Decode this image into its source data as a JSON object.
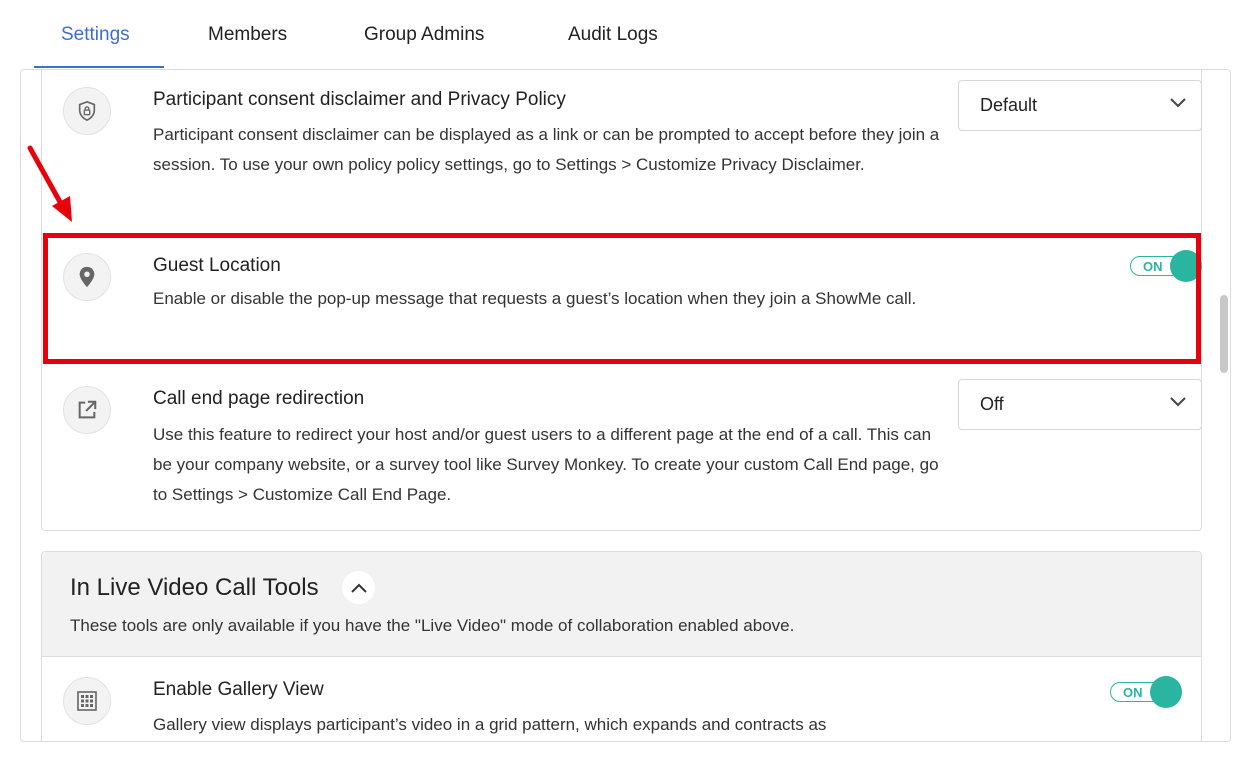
{
  "tabs": [
    {
      "label": "Settings",
      "active": true
    },
    {
      "label": "Members",
      "active": false
    },
    {
      "label": "Group Admins",
      "active": false
    },
    {
      "label": "Audit Logs",
      "active": false
    }
  ],
  "settings": [
    {
      "title": "Participant consent disclaimer and Privacy Policy",
      "description": "Participant consent disclaimer can be displayed as a link or can be prompted to accept before they join a session. To use your own policy policy settings, go to Settings > Customize Privacy Disclaimer.",
      "icon": "shield-lock-icon",
      "control": {
        "type": "select",
        "value": "Default"
      }
    },
    {
      "title": "Guest Location",
      "description": "Enable or disable the pop-up message that requests a guest’s location when they join a ShowMe call.",
      "icon": "location-pin-icon",
      "control": {
        "type": "toggle",
        "label": "ON",
        "on": true
      }
    },
    {
      "title": "Call end page redirection",
      "description": "Use this feature to redirect your host and/or guest users to a different page at the end of a call. This can be your company website, or a survey tool like Survey Monkey. To create your custom Call End page, go to Settings > Customize Call End Page.",
      "icon": "external-link-icon",
      "control": {
        "type": "select",
        "value": "Off"
      }
    }
  ],
  "live_tools": {
    "title": "In Live Video Call Tools",
    "description": "These tools are only available if you have the \"Live Video\" mode of collaboration enabled above.",
    "settings": [
      {
        "title": "Enable Gallery View",
        "description": "Gallery view displays participant’s video in a grid pattern, which expands and contracts as",
        "icon": "grid-icon",
        "control": {
          "type": "toggle",
          "label": "ON",
          "on": true
        }
      }
    ]
  },
  "colors": {
    "accent": "#3b6fd0",
    "toggle": "#2ab5a0",
    "annotation": "#e8000b"
  }
}
